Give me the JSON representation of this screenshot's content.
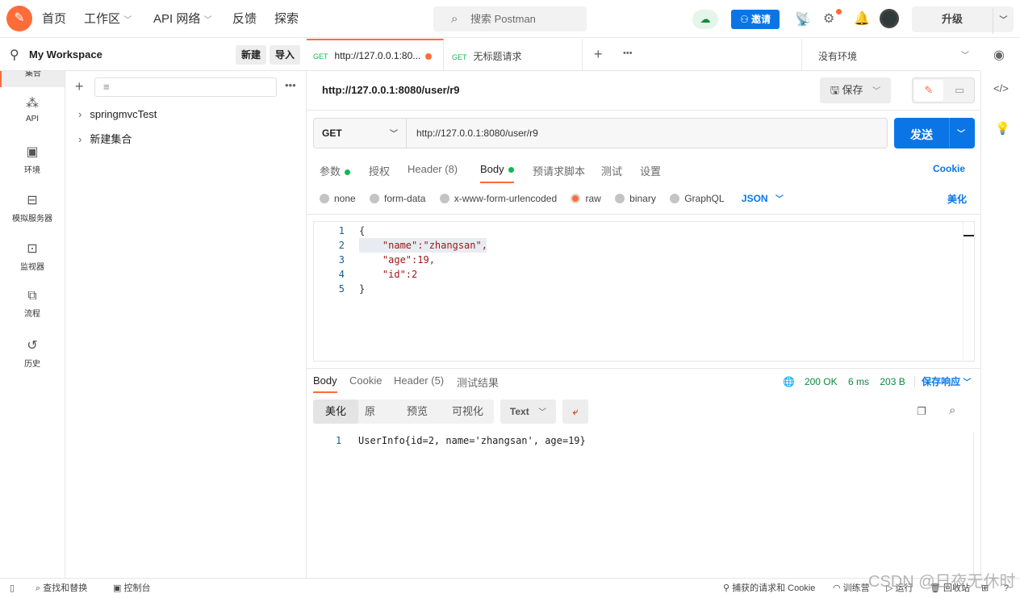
{
  "topbar": {
    "nav": [
      "首页",
      "工作区",
      "API 网络",
      "反馈",
      "探索"
    ],
    "search_placeholder": "搜索 Postman",
    "invite": "邀请",
    "upgrade": "升级"
  },
  "leftnav": [
    "集合",
    "API",
    "环境",
    "模拟服务器",
    "监视器",
    "流程",
    "历史"
  ],
  "sidebar": {
    "workspace": "My Workspace",
    "new": "新建",
    "import": "导入",
    "collections": [
      "springmvcTest",
      "新建集合"
    ]
  },
  "tabs": [
    {
      "method": "GET",
      "title": "http://127.0.0.1:80..."
    },
    {
      "method": "GET",
      "title": "无标题请求"
    }
  ],
  "environment": "没有环境",
  "request": {
    "title": "http://127.0.0.1:8080/user/r9",
    "save": "保存",
    "method": "GET",
    "url": "http://127.0.0.1:8080/user/r9",
    "send": "发送",
    "tabs": [
      "参数",
      "授权",
      "Header (8)",
      "Body",
      "预请求脚本",
      "测试",
      "设置"
    ],
    "cookie": "Cookie",
    "body_types": [
      "none",
      "form-data",
      "x-www-form-urlencoded",
      "raw",
      "binary",
      "GraphQL"
    ],
    "format": "JSON",
    "beautify": "美化",
    "body_lines": [
      "{",
      "    \"name\":\"zhangsan\",",
      "    \"age\":19,",
      "    \"id\":2",
      "}"
    ]
  },
  "response": {
    "tabs": [
      "Body",
      "Cookie",
      "Header (5)",
      "测试结果"
    ],
    "status": "200 OK",
    "time": "6 ms",
    "size": "203 B",
    "save": "保存响应",
    "views": [
      "美化",
      "原",
      "预览",
      "可视化"
    ],
    "format": "Text",
    "lines": [
      "UserInfo{id=2, name='zhangsan', age=19}"
    ]
  },
  "footer": {
    "find": "查找和替换",
    "console": "控制台",
    "capture": "捕获的请求和 Cookie",
    "bootcamp": "训练营",
    "runner": "运行",
    "trash": "回收站"
  },
  "watermark": "CSDN @日夜无休时",
  "colors": {
    "accent": "#ff6c37",
    "primary": "#0b75e6",
    "success": "#0cbb52"
  }
}
